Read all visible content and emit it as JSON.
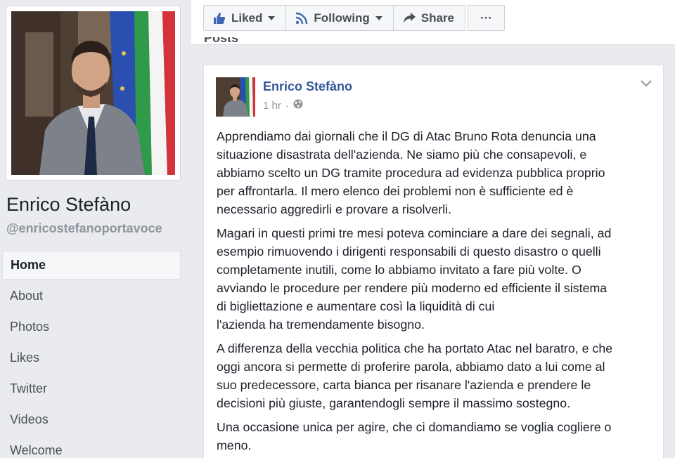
{
  "profile": {
    "name": "Enrico Stefàno",
    "handle": "@enricostefanoportavoce"
  },
  "nav": {
    "items": [
      {
        "label": "Home",
        "active": true
      },
      {
        "label": "About"
      },
      {
        "label": "Photos"
      },
      {
        "label": "Likes"
      },
      {
        "label": "Twitter"
      },
      {
        "label": "Videos"
      },
      {
        "label": "Welcome"
      }
    ]
  },
  "actions": {
    "liked_label": "Liked",
    "following_label": "Following",
    "share_label": "Share",
    "more_label": "···"
  },
  "section": {
    "label": "Posts"
  },
  "post": {
    "author": "Enrico Stefàno",
    "time": "1 hr",
    "separator": "·",
    "paragraphs": [
      "Apprendiamo dai giornali che il DG di Atac Bruno Rota denuncia una\nsituazione disastrata dell'azienda. Ne siamo più che consapevoli, e\nabbiamo scelto un DG tramite procedura ad evidenza pubblica proprio\nper affrontarla. Il mero elenco dei problemi non è sufficiente ed è\nnecessario aggredirli e provare a risolverli.",
      "Magari in questi primi tre mesi poteva cominciare a dare dei segnali, ad\nesempio rimuovendo i dirigenti responsabili di questo disastro o quelli\ncompletamente inutili, come lo abbiamo invitato a fare più volte. O\navviando le procedure per rendere più moderno ed efficiente il sistema\ndi bigliettazione e aumentare così la liquidità di cui\nl'azienda ha tremendamente bisogno.",
      "A differenza della vecchia politica che ha portato Atac nel baratro, e che\noggi ancora si permette di proferire parola, abbiamo dato a lui come al\nsuo predecessore, carta bianca per risanare l'azienda e prendere le\ndecisioni più giuste, garantendogli sempre il massimo sostegno.",
      "Una occasione unica per agire, che ci domandiamo se voglia cogliere o\nmeno."
    ]
  },
  "colors": {
    "link": "#365899",
    "muted": "#90949c",
    "background": "#e9ebee"
  }
}
